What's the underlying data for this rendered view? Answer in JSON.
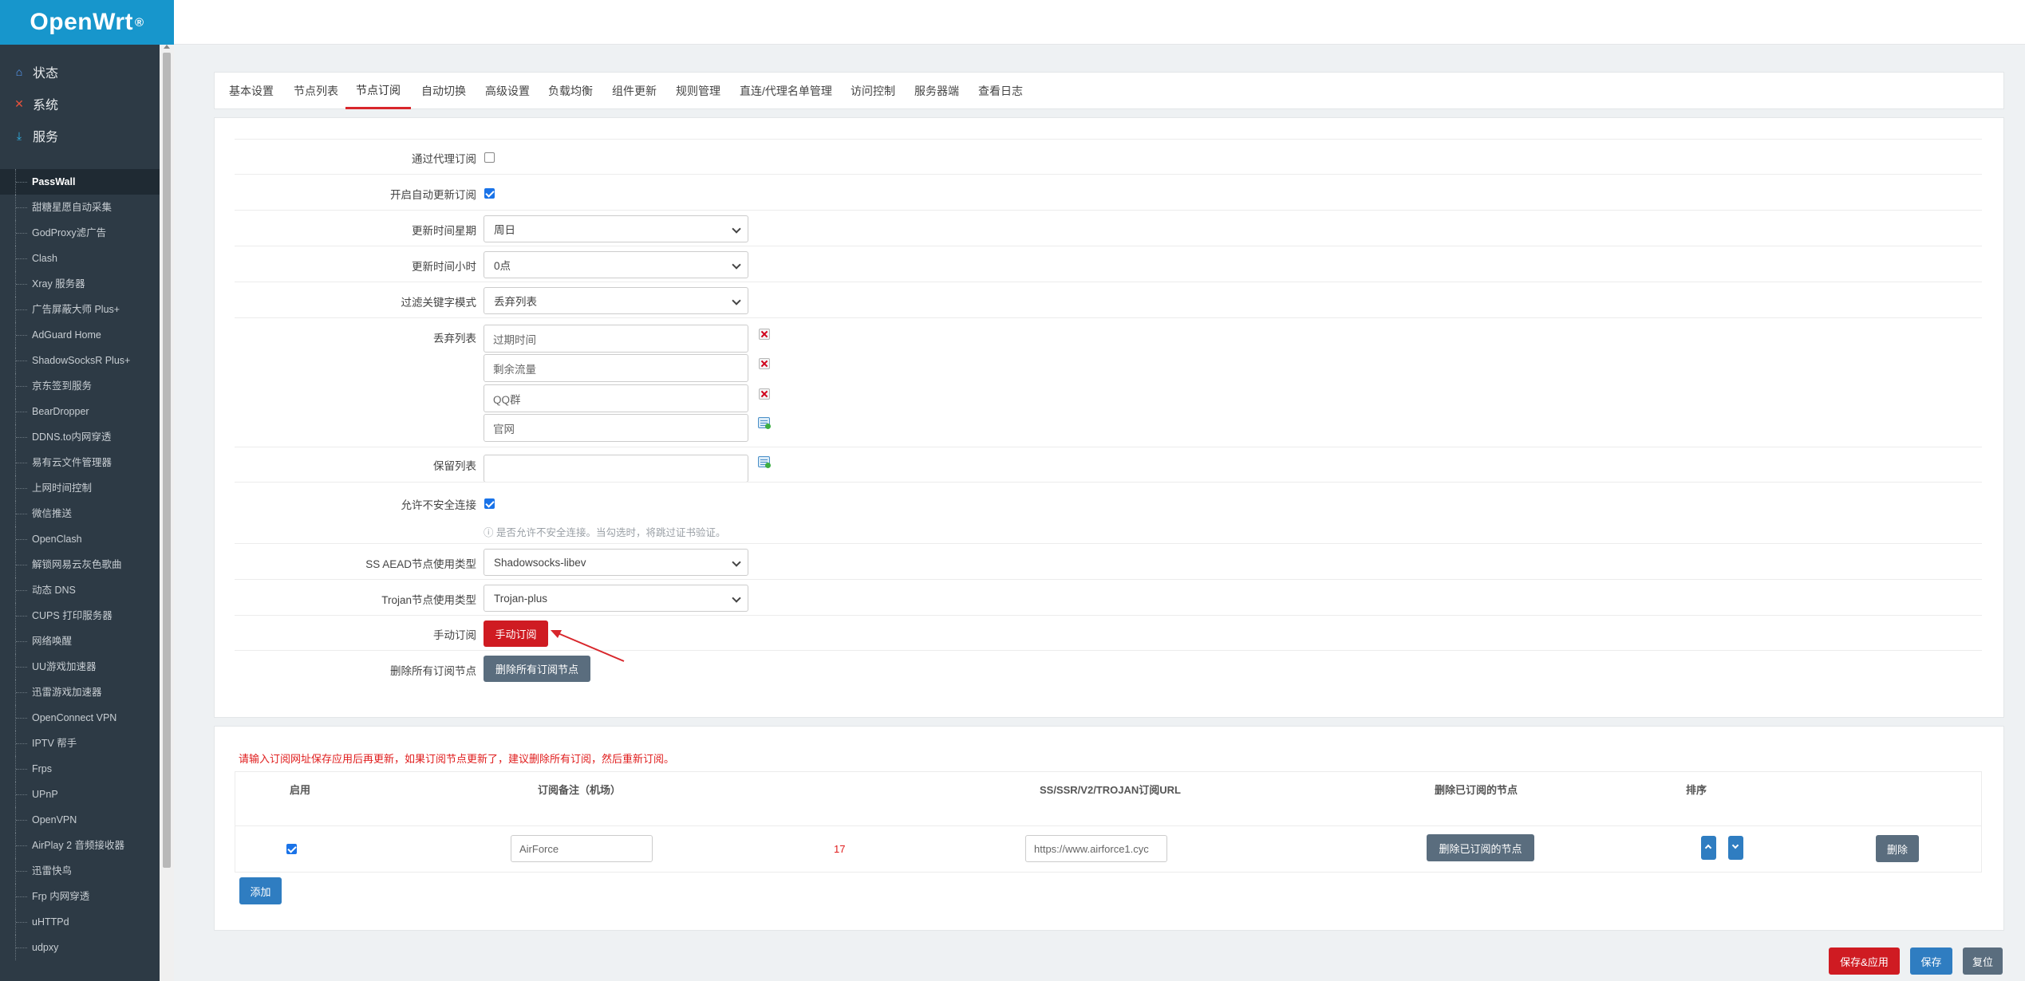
{
  "brand": {
    "name": "OpenWrt",
    "mark": "®"
  },
  "sidebar": {
    "categories": [
      {
        "label": "状态",
        "icon": "home-icon"
      },
      {
        "label": "系统",
        "icon": "tools-icon"
      },
      {
        "label": "服务",
        "icon": "download-icon"
      }
    ],
    "items": [
      "PassWall",
      "甜糖星愿自动采集",
      "GodProxy滤广告",
      "Clash",
      "Xray 服务器",
      "广告屏蔽大师 Plus+",
      "AdGuard Home",
      "ShadowSocksR Plus+",
      "京东签到服务",
      "BearDropper",
      "DDNS.to内网穿透",
      "易有云文件管理器",
      "上网时间控制",
      "微信推送",
      "OpenClash",
      "解锁网易云灰色歌曲",
      "动态 DNS",
      "CUPS 打印服务器",
      "网络唤醒",
      "UU游戏加速器",
      "迅雷游戏加速器",
      "OpenConnect VPN",
      "IPTV 帮手",
      "Frps",
      "UPnP",
      "OpenVPN",
      "AirPlay 2 音频接收器",
      "迅雷快鸟",
      "Frp 内网穿透",
      "uHTTPd",
      "udpxy"
    ],
    "active_item": "PassWall"
  },
  "tabs": [
    "基本设置",
    "节点列表",
    "节点订阅",
    "自动切换",
    "高级设置",
    "负载均衡",
    "组件更新",
    "规则管理",
    "直连/代理名单管理",
    "访问控制",
    "服务器端",
    "查看日志"
  ],
  "active_tab": "节点订阅",
  "form": {
    "subscribe_via_proxy": {
      "label": "通过代理订阅",
      "checked": false
    },
    "auto_update": {
      "label": "开启自动更新订阅",
      "checked": true
    },
    "update_weekday": {
      "label": "更新时间星期",
      "value": "周日"
    },
    "update_hour": {
      "label": "更新时间小时",
      "value": "0点"
    },
    "filter_mode": {
      "label": "过滤关键字模式",
      "value": "丢弃列表"
    },
    "discard_list": {
      "label": "丢弃列表",
      "values": [
        "过期时间",
        "剩余流量",
        "QQ群",
        "官网"
      ]
    },
    "keep_list": {
      "label": "保留列表",
      "value": ""
    },
    "allow_insecure": {
      "label": "允许不安全连接",
      "checked": true,
      "hint": "是否允许不安全连接。当勾选时，将跳过证书验证。"
    },
    "ss_aead_type": {
      "label": "SS AEAD节点使用类型",
      "value": "Shadowsocks-libev"
    },
    "trojan_type": {
      "label": "Trojan节点使用类型",
      "value": "Trojan-plus"
    },
    "manual_subscribe": {
      "label": "手动订阅",
      "button": "手动订阅"
    },
    "delete_all_nodes": {
      "label": "删除所有订阅节点",
      "button": "删除所有订阅节点"
    }
  },
  "subscriptions": {
    "warning": "请输入订阅网址保存应用后再更新，如果订阅节点更新了，建议删除所有订阅，然后重新订阅。",
    "headers": [
      "启用",
      "订阅备注（机场）",
      "SS/SSR/V2/TROJAN订阅URL",
      "删除已订阅的节点",
      "排序"
    ],
    "rows": [
      {
        "enabled": true,
        "remark": "AirForce",
        "count": "17",
        "url": "https://www.airforce1.cyc",
        "delete_nodes_button": "删除已订阅的节点",
        "delete_button": "删除"
      }
    ],
    "add_button": "添加"
  },
  "footer": {
    "save_apply": "保存&应用",
    "save": "保存",
    "reset": "复位"
  },
  "colors": {
    "brand": "#1796cc",
    "sidebar": "#2d3a45",
    "danger": "#cf1b22",
    "primary": "#2f7dc1",
    "muted_button": "#5a6d7e"
  }
}
